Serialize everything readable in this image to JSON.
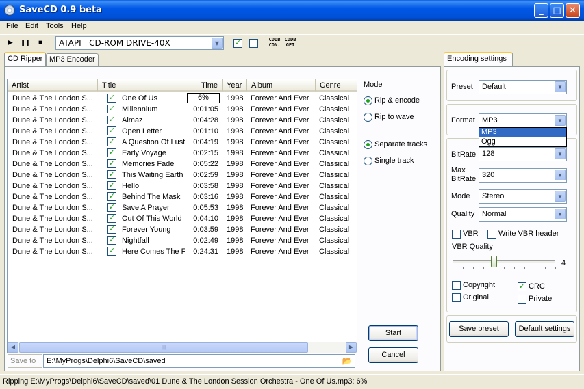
{
  "window": {
    "title": "SaveCD 0.9 beta"
  },
  "menu": [
    "File",
    "Edit",
    "Tools",
    "Help"
  ],
  "toolbar": {
    "play": "▶",
    "pause": "❚❚",
    "stop": "■",
    "drive": "ATAPI   CD-ROM DRIVE-40X",
    "cddb_con": [
      "CDDB",
      "CON."
    ],
    "cddb_get": [
      "CDDB",
      "GET"
    ]
  },
  "tabs": {
    "ripper": "CD Ripper",
    "encoder": "MP3 Encoder",
    "encoding": "Encoding settings"
  },
  "columns": [
    "Artist",
    "Title",
    "Time",
    "Year",
    "Album",
    "Genre"
  ],
  "tracks": [
    {
      "artist": "Dune & The London S...",
      "title": "One Of Us",
      "time": "6%",
      "year": "1998",
      "album": "Forever And Ever",
      "genre": "Classical"
    },
    {
      "artist": "Dune & The London S...",
      "title": "Millennium",
      "time": "0:01:05",
      "year": "1998",
      "album": "Forever And Ever",
      "genre": "Classical"
    },
    {
      "artist": "Dune & The London S...",
      "title": "Almaz",
      "time": "0:04:28",
      "year": "1998",
      "album": "Forever And Ever",
      "genre": "Classical"
    },
    {
      "artist": "Dune & The London S...",
      "title": "Open Letter",
      "time": "0:01:10",
      "year": "1998",
      "album": "Forever And Ever",
      "genre": "Classical"
    },
    {
      "artist": "Dune & The London S...",
      "title": "A Question Of Lust",
      "time": "0:04:19",
      "year": "1998",
      "album": "Forever And Ever",
      "genre": "Classical"
    },
    {
      "artist": "Dune & The London S...",
      "title": "Early Voyage",
      "time": "0:02:15",
      "year": "1998",
      "album": "Forever And Ever",
      "genre": "Classical"
    },
    {
      "artist": "Dune & The London S...",
      "title": "Memories Fade",
      "time": "0:05:22",
      "year": "1998",
      "album": "Forever And Ever",
      "genre": "Classical"
    },
    {
      "artist": "Dune & The London S...",
      "title": "This Waiting Earth",
      "time": "0:02:59",
      "year": "1998",
      "album": "Forever And Ever",
      "genre": "Classical"
    },
    {
      "artist": "Dune & The London S...",
      "title": "Hello",
      "time": "0:03:58",
      "year": "1998",
      "album": "Forever And Ever",
      "genre": "Classical"
    },
    {
      "artist": "Dune & The London S...",
      "title": "Behind The Mask",
      "time": "0:03:16",
      "year": "1998",
      "album": "Forever And Ever",
      "genre": "Classical"
    },
    {
      "artist": "Dune & The London S...",
      "title": "Save A Prayer",
      "time": "0:05:53",
      "year": "1998",
      "album": "Forever And Ever",
      "genre": "Classical"
    },
    {
      "artist": "Dune & The London S...",
      "title": "Out Of This World",
      "time": "0:04:10",
      "year": "1998",
      "album": "Forever And Ever",
      "genre": "Classical"
    },
    {
      "artist": "Dune & The London S...",
      "title": "Forever Young",
      "time": "0:03:59",
      "year": "1998",
      "album": "Forever And Ever",
      "genre": "Classical"
    },
    {
      "artist": "Dune & The London S...",
      "title": "Nightfall",
      "time": "0:02:49",
      "year": "1998",
      "album": "Forever And Ever",
      "genre": "Classical"
    },
    {
      "artist": "Dune & The London S...",
      "title": "Here Comes The F",
      "time": "0:24:31",
      "year": "1998",
      "album": "Forever And Ever",
      "genre": "Classical"
    }
  ],
  "mode": {
    "label": "Mode",
    "rip_encode": "Rip & encode",
    "rip_wave": "Rip to wave",
    "separate": "Separate tracks",
    "single": "Single track"
  },
  "actions": {
    "start": "Start",
    "cancel": "Cancel"
  },
  "save_to": {
    "label": "Save to",
    "path": "E:\\MyProgs\\Delphi6\\SaveCD\\saved"
  },
  "encoding": {
    "preset_label": "Preset",
    "preset": "Default",
    "format_label": "Format",
    "format": "MP3",
    "format_options": [
      "MP3",
      "Ogg"
    ],
    "bitrate_label": "BitRate",
    "bitrate": "128",
    "maxbitrate_label": [
      "Max",
      "BitRate"
    ],
    "maxbitrate": "320",
    "mode_label": "Mode",
    "mode": "Stereo",
    "quality_label": "Quality",
    "quality": "Normal",
    "vbr": "VBR",
    "write_vbr": "Write VBR header",
    "vbr_quality_label": "VBR Quality",
    "vbr_quality_value": "4",
    "copyright": "Copyright",
    "crc": "CRC",
    "original": "Original",
    "private": "Private",
    "save_preset": "Save preset",
    "default_settings": "Default settings"
  },
  "status": "Ripping E:\\MyProgs\\Delphi6\\SaveCD\\saved\\01 Dune & The London Session Orchestra - One Of Us.mp3: 6%"
}
